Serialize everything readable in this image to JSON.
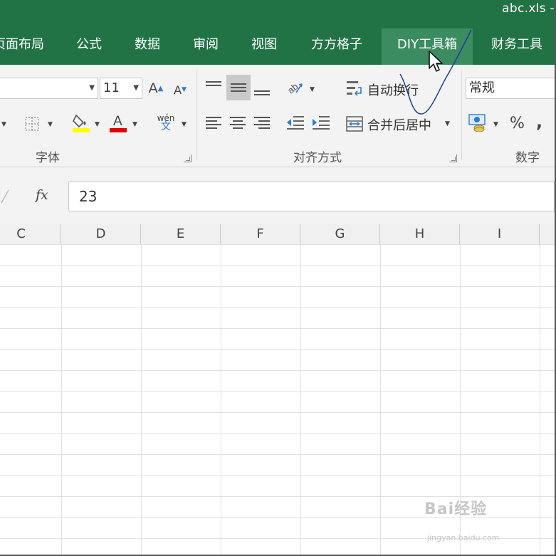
{
  "window": {
    "title": "abc.xls -"
  },
  "tabs": [
    {
      "label": "页面布局",
      "state": "normal"
    },
    {
      "label": "公式",
      "state": "normal"
    },
    {
      "label": "数据",
      "state": "normal"
    },
    {
      "label": "审阅",
      "state": "normal"
    },
    {
      "label": "视图",
      "state": "normal"
    },
    {
      "label": "方方格子",
      "state": "normal"
    },
    {
      "label": "DIY工具箱",
      "state": "hover"
    },
    {
      "label": "财务工具",
      "state": "normal"
    }
  ],
  "ribbon": {
    "font": {
      "size_value": "11",
      "group_label": "字体",
      "wen_label": "wén",
      "wen_sub": "文"
    },
    "alignment": {
      "wrap_text_label": "自动换行",
      "merge_center_label": "合并后居中",
      "group_label": "对齐方式"
    },
    "number": {
      "format_value": "常规",
      "percent_label": "%",
      "comma_label": ",",
      "group_label": "数字"
    }
  },
  "formula_bar": {
    "fx_label": "fx",
    "value": "23"
  },
  "columns": [
    "C",
    "D",
    "E",
    "F",
    "G",
    "H",
    "I"
  ],
  "watermark": {
    "text": "Bai经验",
    "sub": "jingyan.baidu.com"
  },
  "colors": {
    "ribbon_green": "#217346",
    "tab_hover": "#3c8c61",
    "fill_highlight": "#ffff00",
    "font_color_red": "#e00000",
    "annotation_ink": "#1f3f8f"
  },
  "icons": [
    "increase-font-icon",
    "decrease-font-icon",
    "border-icon",
    "fill-color-icon",
    "font-color-icon",
    "phonetic-icon",
    "text-orientation-icon",
    "wrap-text-icon",
    "merge-center-icon",
    "indent-decrease-icon",
    "indent-increase-icon",
    "currency-icon",
    "percent-icon",
    "comma-icon",
    "mouse-cursor-icon"
  ]
}
